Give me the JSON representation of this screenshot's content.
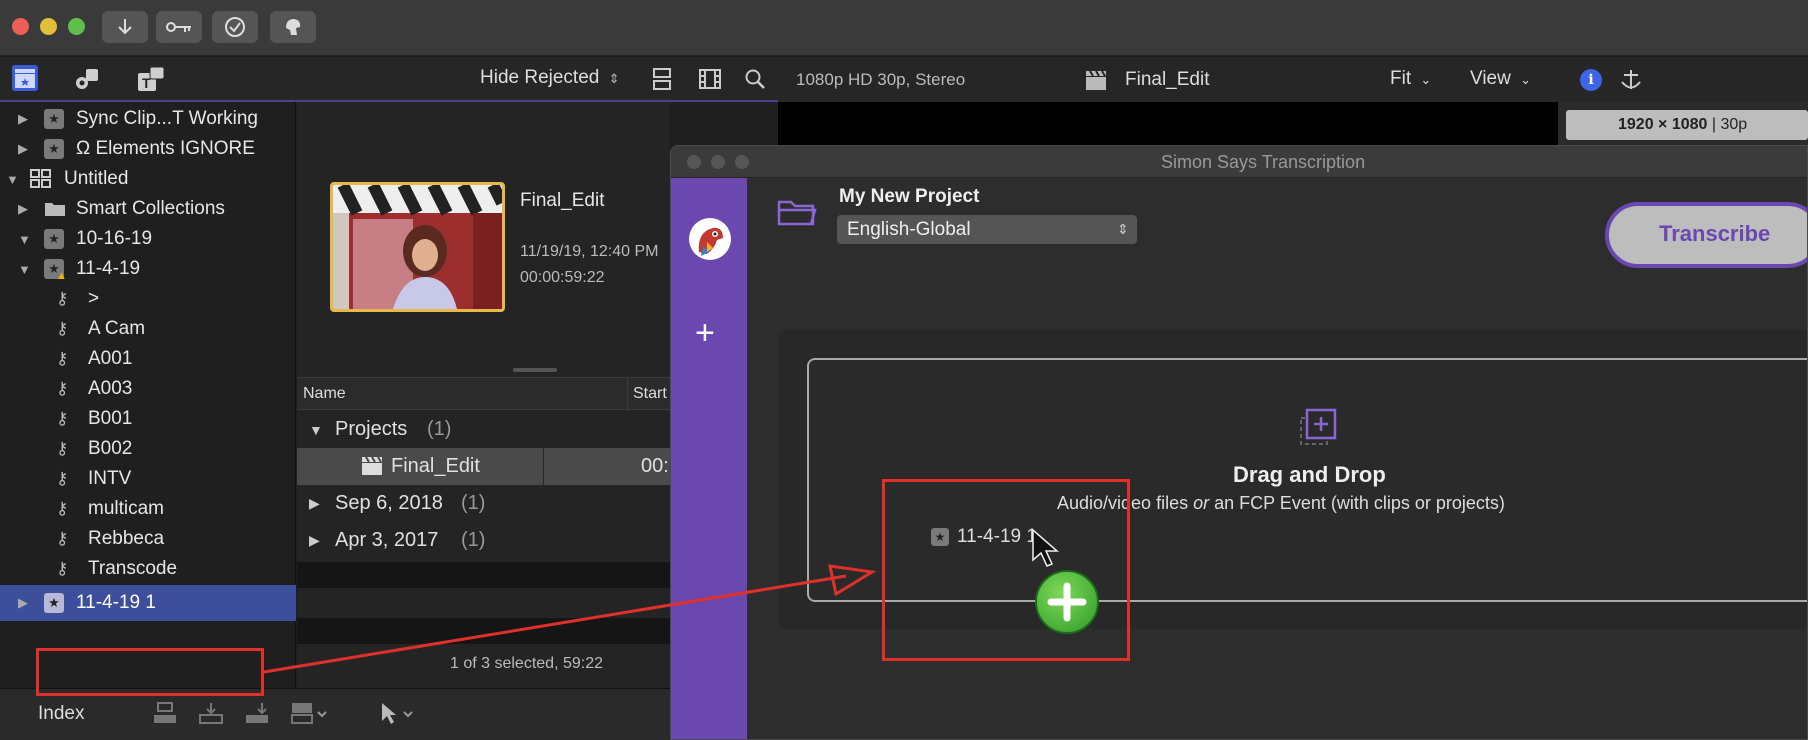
{
  "toolbar": {
    "buttons": [
      "download-icon",
      "key-icon",
      "checkmark-icon",
      "voiceover-icon"
    ]
  },
  "library_header": {
    "filter_label": "Hide Rejected",
    "filter_arrow": "⌃"
  },
  "viewer_header": {
    "format": "1080p HD 30p, Stereo",
    "project": "Final_Edit",
    "fit": "Fit",
    "view": "View"
  },
  "inspector": {
    "resolution": "1920 × 1080",
    "rate": "30p"
  },
  "sidebar": {
    "items": [
      {
        "label": "Sync Clip...T Working"
      },
      {
        "label": "Ω Elements IGNORE"
      },
      {
        "label": "Untitled"
      },
      {
        "label": "Smart Collections"
      },
      {
        "label": "10-16-19"
      },
      {
        "label": "11-4-19"
      },
      {
        "label": ">"
      },
      {
        "label": "A Cam"
      },
      {
        "label": "A001"
      },
      {
        "label": "A003"
      },
      {
        "label": "B001"
      },
      {
        "label": "B002"
      },
      {
        "label": "INTV"
      },
      {
        "label": "multicam"
      },
      {
        "label": "Rebbeca"
      },
      {
        "label": "Transcode"
      },
      {
        "label": "11-4-19 1"
      }
    ]
  },
  "clip": {
    "name": "Final_Edit",
    "date": "11/19/19, 12:40 PM",
    "duration": "00:00:59:22"
  },
  "list": {
    "col_name": "Name",
    "col_start": "Start",
    "rows": [
      {
        "label": "Projects",
        "count": "(1)"
      },
      {
        "label": "Final_Edit",
        "start": "00:"
      },
      {
        "label": "Sep 6, 2018",
        "count": "(1)"
      },
      {
        "label": "Apr 3, 2017",
        "count": "(1)"
      }
    ],
    "status": "1 of 3 selected, 59:22"
  },
  "bottom": {
    "index": "Index"
  },
  "simon": {
    "window_title": "Simon Says Transcription",
    "project_name": "My New Project",
    "language": "English-Global",
    "transcribe": "Transcribe",
    "drop_title": "Drag and Drop",
    "drop_sub_a": "Audio/video files ",
    "drop_sub_or": "or",
    "drop_sub_b": " an FCP Event (with clips or projects)",
    "drag_item": "11-4-19 1"
  },
  "colors": {
    "purple": "#6a48b0",
    "annotation_red": "#e0302a",
    "selection": "#3d4f9a"
  }
}
